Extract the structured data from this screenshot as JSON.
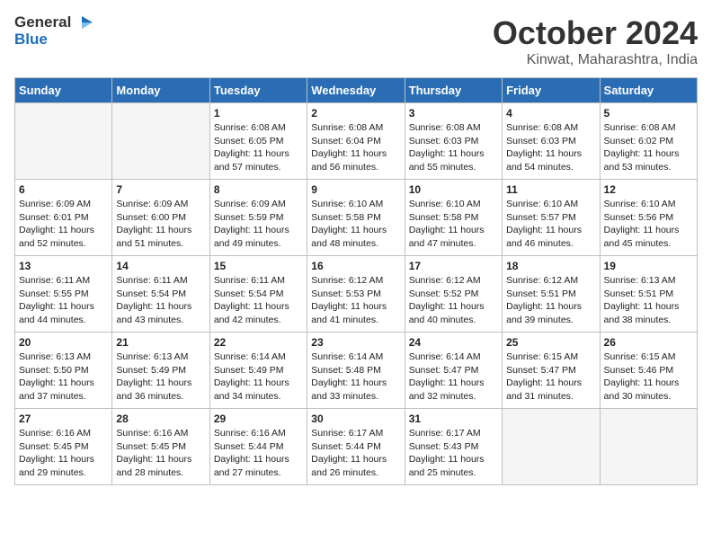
{
  "header": {
    "logo_general": "General",
    "logo_blue": "Blue",
    "month": "October 2024",
    "location": "Kinwat, Maharashtra, India"
  },
  "weekdays": [
    "Sunday",
    "Monday",
    "Tuesday",
    "Wednesday",
    "Thursday",
    "Friday",
    "Saturday"
  ],
  "weeks": [
    [
      {
        "day": "",
        "sunrise": "",
        "sunset": "",
        "daylight": "",
        "empty": true
      },
      {
        "day": "",
        "sunrise": "",
        "sunset": "",
        "daylight": "",
        "empty": true
      },
      {
        "day": "1",
        "sunrise": "Sunrise: 6:08 AM",
        "sunset": "Sunset: 6:05 PM",
        "daylight": "Daylight: 11 hours and 57 minutes.",
        "empty": false
      },
      {
        "day": "2",
        "sunrise": "Sunrise: 6:08 AM",
        "sunset": "Sunset: 6:04 PM",
        "daylight": "Daylight: 11 hours and 56 minutes.",
        "empty": false
      },
      {
        "day": "3",
        "sunrise": "Sunrise: 6:08 AM",
        "sunset": "Sunset: 6:03 PM",
        "daylight": "Daylight: 11 hours and 55 minutes.",
        "empty": false
      },
      {
        "day": "4",
        "sunrise": "Sunrise: 6:08 AM",
        "sunset": "Sunset: 6:03 PM",
        "daylight": "Daylight: 11 hours and 54 minutes.",
        "empty": false
      },
      {
        "day": "5",
        "sunrise": "Sunrise: 6:08 AM",
        "sunset": "Sunset: 6:02 PM",
        "daylight": "Daylight: 11 hours and 53 minutes.",
        "empty": false
      }
    ],
    [
      {
        "day": "6",
        "sunrise": "Sunrise: 6:09 AM",
        "sunset": "Sunset: 6:01 PM",
        "daylight": "Daylight: 11 hours and 52 minutes.",
        "empty": false
      },
      {
        "day": "7",
        "sunrise": "Sunrise: 6:09 AM",
        "sunset": "Sunset: 6:00 PM",
        "daylight": "Daylight: 11 hours and 51 minutes.",
        "empty": false
      },
      {
        "day": "8",
        "sunrise": "Sunrise: 6:09 AM",
        "sunset": "Sunset: 5:59 PM",
        "daylight": "Daylight: 11 hours and 49 minutes.",
        "empty": false
      },
      {
        "day": "9",
        "sunrise": "Sunrise: 6:10 AM",
        "sunset": "Sunset: 5:58 PM",
        "daylight": "Daylight: 11 hours and 48 minutes.",
        "empty": false
      },
      {
        "day": "10",
        "sunrise": "Sunrise: 6:10 AM",
        "sunset": "Sunset: 5:58 PM",
        "daylight": "Daylight: 11 hours and 47 minutes.",
        "empty": false
      },
      {
        "day": "11",
        "sunrise": "Sunrise: 6:10 AM",
        "sunset": "Sunset: 5:57 PM",
        "daylight": "Daylight: 11 hours and 46 minutes.",
        "empty": false
      },
      {
        "day": "12",
        "sunrise": "Sunrise: 6:10 AM",
        "sunset": "Sunset: 5:56 PM",
        "daylight": "Daylight: 11 hours and 45 minutes.",
        "empty": false
      }
    ],
    [
      {
        "day": "13",
        "sunrise": "Sunrise: 6:11 AM",
        "sunset": "Sunset: 5:55 PM",
        "daylight": "Daylight: 11 hours and 44 minutes.",
        "empty": false
      },
      {
        "day": "14",
        "sunrise": "Sunrise: 6:11 AM",
        "sunset": "Sunset: 5:54 PM",
        "daylight": "Daylight: 11 hours and 43 minutes.",
        "empty": false
      },
      {
        "day": "15",
        "sunrise": "Sunrise: 6:11 AM",
        "sunset": "Sunset: 5:54 PM",
        "daylight": "Daylight: 11 hours and 42 minutes.",
        "empty": false
      },
      {
        "day": "16",
        "sunrise": "Sunrise: 6:12 AM",
        "sunset": "Sunset: 5:53 PM",
        "daylight": "Daylight: 11 hours and 41 minutes.",
        "empty": false
      },
      {
        "day": "17",
        "sunrise": "Sunrise: 6:12 AM",
        "sunset": "Sunset: 5:52 PM",
        "daylight": "Daylight: 11 hours and 40 minutes.",
        "empty": false
      },
      {
        "day": "18",
        "sunrise": "Sunrise: 6:12 AM",
        "sunset": "Sunset: 5:51 PM",
        "daylight": "Daylight: 11 hours and 39 minutes.",
        "empty": false
      },
      {
        "day": "19",
        "sunrise": "Sunrise: 6:13 AM",
        "sunset": "Sunset: 5:51 PM",
        "daylight": "Daylight: 11 hours and 38 minutes.",
        "empty": false
      }
    ],
    [
      {
        "day": "20",
        "sunrise": "Sunrise: 6:13 AM",
        "sunset": "Sunset: 5:50 PM",
        "daylight": "Daylight: 11 hours and 37 minutes.",
        "empty": false
      },
      {
        "day": "21",
        "sunrise": "Sunrise: 6:13 AM",
        "sunset": "Sunset: 5:49 PM",
        "daylight": "Daylight: 11 hours and 36 minutes.",
        "empty": false
      },
      {
        "day": "22",
        "sunrise": "Sunrise: 6:14 AM",
        "sunset": "Sunset: 5:49 PM",
        "daylight": "Daylight: 11 hours and 34 minutes.",
        "empty": false
      },
      {
        "day": "23",
        "sunrise": "Sunrise: 6:14 AM",
        "sunset": "Sunset: 5:48 PM",
        "daylight": "Daylight: 11 hours and 33 minutes.",
        "empty": false
      },
      {
        "day": "24",
        "sunrise": "Sunrise: 6:14 AM",
        "sunset": "Sunset: 5:47 PM",
        "daylight": "Daylight: 11 hours and 32 minutes.",
        "empty": false
      },
      {
        "day": "25",
        "sunrise": "Sunrise: 6:15 AM",
        "sunset": "Sunset: 5:47 PM",
        "daylight": "Daylight: 11 hours and 31 minutes.",
        "empty": false
      },
      {
        "day": "26",
        "sunrise": "Sunrise: 6:15 AM",
        "sunset": "Sunset: 5:46 PM",
        "daylight": "Daylight: 11 hours and 30 minutes.",
        "empty": false
      }
    ],
    [
      {
        "day": "27",
        "sunrise": "Sunrise: 6:16 AM",
        "sunset": "Sunset: 5:45 PM",
        "daylight": "Daylight: 11 hours and 29 minutes.",
        "empty": false
      },
      {
        "day": "28",
        "sunrise": "Sunrise: 6:16 AM",
        "sunset": "Sunset: 5:45 PM",
        "daylight": "Daylight: 11 hours and 28 minutes.",
        "empty": false
      },
      {
        "day": "29",
        "sunrise": "Sunrise: 6:16 AM",
        "sunset": "Sunset: 5:44 PM",
        "daylight": "Daylight: 11 hours and 27 minutes.",
        "empty": false
      },
      {
        "day": "30",
        "sunrise": "Sunrise: 6:17 AM",
        "sunset": "Sunset: 5:44 PM",
        "daylight": "Daylight: 11 hours and 26 minutes.",
        "empty": false
      },
      {
        "day": "31",
        "sunrise": "Sunrise: 6:17 AM",
        "sunset": "Sunset: 5:43 PM",
        "daylight": "Daylight: 11 hours and 25 minutes.",
        "empty": false
      },
      {
        "day": "",
        "sunrise": "",
        "sunset": "",
        "daylight": "",
        "empty": true
      },
      {
        "day": "",
        "sunrise": "",
        "sunset": "",
        "daylight": "",
        "empty": true
      }
    ]
  ]
}
